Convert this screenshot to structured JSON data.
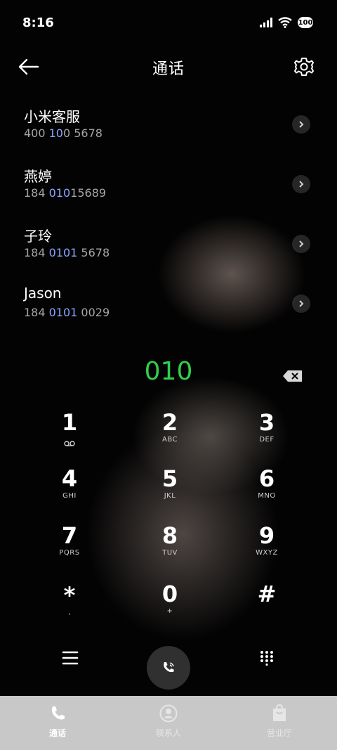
{
  "status": {
    "time": "8:16",
    "battery": "100"
  },
  "header": {
    "title": "通话"
  },
  "results": [
    {
      "name": "小米客服",
      "num_pre": "400 ",
      "num_hl": "10",
      "num_post": "0 5678"
    },
    {
      "name": "燕婷",
      "num_pre": "184 ",
      "num_hl": "010",
      "num_post": "15689"
    },
    {
      "name": "子玲",
      "num_pre": "184 ",
      "num_hl": "0101",
      "num_post": " 5678"
    },
    {
      "name": "Jason",
      "num_pre": "184 ",
      "num_hl": "0101",
      "num_post": " 0029"
    }
  ],
  "dialer": {
    "entered": "010"
  },
  "keypad": [
    {
      "d": "1",
      "l": ""
    },
    {
      "d": "2",
      "l": "ABC"
    },
    {
      "d": "3",
      "l": "DEF"
    },
    {
      "d": "4",
      "l": "GHI"
    },
    {
      "d": "5",
      "l": "JKL"
    },
    {
      "d": "6",
      "l": "MNO"
    },
    {
      "d": "7",
      "l": "PQRS"
    },
    {
      "d": "8",
      "l": "TUV"
    },
    {
      "d": "9",
      "l": "WXYZ"
    },
    {
      "d": "*",
      "l": ","
    },
    {
      "d": "0",
      "l": "+"
    },
    {
      "d": "#",
      "l": ""
    }
  ],
  "tabs": [
    {
      "label": "通话"
    },
    {
      "label": "联系人"
    },
    {
      "label": "营业厅"
    }
  ],
  "colors": {
    "entered_digits": "#2fcf4c",
    "match_highlight": "#8ea6ff",
    "tabbar": "#c8c8c8"
  }
}
